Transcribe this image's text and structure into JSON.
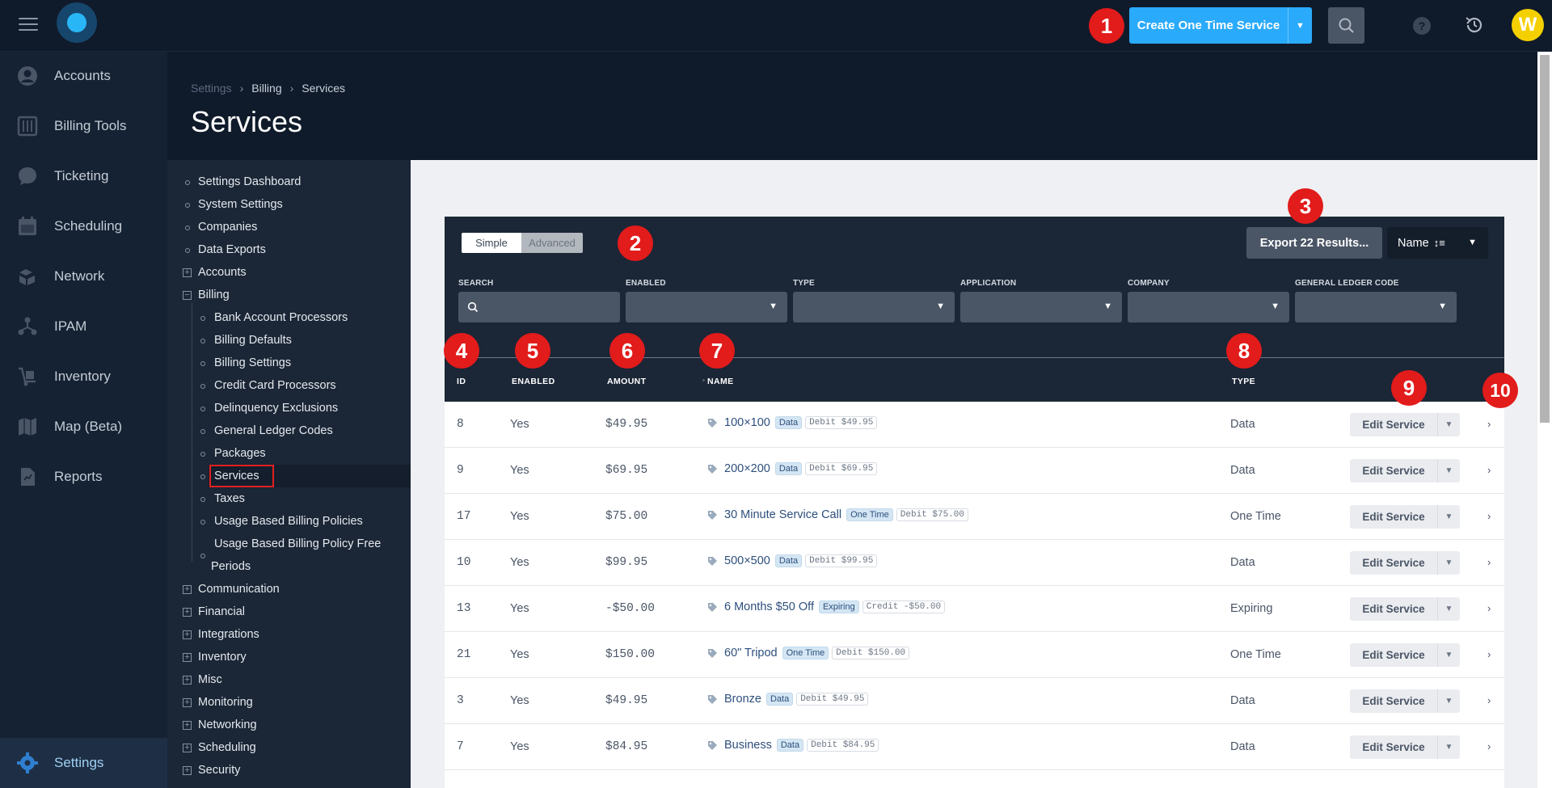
{
  "topbar": {
    "create_button": "Create One Time Service",
    "avatar_initial": "W",
    "help": "?"
  },
  "annotations": [
    "1",
    "2",
    "3",
    "4",
    "5",
    "6",
    "7",
    "8",
    "9",
    "10"
  ],
  "leftnav": {
    "items": [
      "Accounts",
      "Billing Tools",
      "Ticketing",
      "Scheduling",
      "Network",
      "IPAM",
      "Inventory",
      "Map (Beta)",
      "Reports"
    ],
    "settings": "Settings"
  },
  "header": {
    "breadcrumb": [
      "Settings",
      "Billing",
      "Services"
    ],
    "title": "Services"
  },
  "tree": {
    "top": [
      "Settings Dashboard",
      "System Settings",
      "Companies",
      "Data Exports"
    ],
    "accounts": "Accounts",
    "billing": "Billing",
    "billing_children": [
      "Bank Account Processors",
      "Billing Defaults",
      "Billing Settings",
      "Credit Card Processors",
      "Delinquency Exclusions",
      "General Ledger Codes",
      "Packages",
      "Services",
      "Taxes",
      "Usage Based Billing Policies",
      "Usage Based Billing Policy Free",
      "Periods"
    ],
    "groups": [
      "Communication",
      "Financial",
      "Integrations",
      "Inventory",
      "Misc",
      "Monitoring",
      "Networking",
      "Scheduling",
      "Security"
    ]
  },
  "toolbar": {
    "simple": "Simple",
    "advanced": "Advanced",
    "export": "Export 22 Results...",
    "sort": "Name"
  },
  "filters": [
    "SEARCH",
    "ENABLED",
    "TYPE",
    "APPLICATION",
    "COMPANY",
    "GENERAL LEDGER CODE"
  ],
  "columns": {
    "id": "ID",
    "enabled": "ENABLED",
    "amount": "AMOUNT",
    "name": "NAME",
    "type": "TYPE"
  },
  "rows": [
    {
      "id": "8",
      "enabled": "Yes",
      "amount": "$49.95",
      "name": "100×100",
      "tag": "Data",
      "debit": "Debit $49.95",
      "type": "Data",
      "action": "Edit Service"
    },
    {
      "id": "9",
      "enabled": "Yes",
      "amount": "$69.95",
      "name": "200×200",
      "tag": "Data",
      "debit": "Debit $69.95",
      "type": "Data",
      "action": "Edit Service"
    },
    {
      "id": "17",
      "enabled": "Yes",
      "amount": "$75.00",
      "name": "30 Minute Service Call",
      "tag": "One Time",
      "debit": "Debit $75.00",
      "type": "One Time",
      "action": "Edit Service"
    },
    {
      "id": "10",
      "enabled": "Yes",
      "amount": "$99.95",
      "name": "500×500",
      "tag": "Data",
      "debit": "Debit $99.95",
      "type": "Data",
      "action": "Edit Service"
    },
    {
      "id": "13",
      "enabled": "Yes",
      "amount": "-$50.00",
      "name": "6 Months $50 Off",
      "tag": "Expiring",
      "debit": "Credit -$50.00",
      "type": "Expiring",
      "action": "Edit Service"
    },
    {
      "id": "21",
      "enabled": "Yes",
      "amount": "$150.00",
      "name": "60\" Tripod",
      "tag": "One Time",
      "debit": "Debit $150.00",
      "type": "One Time",
      "action": "Edit Service"
    },
    {
      "id": "3",
      "enabled": "Yes",
      "amount": "$49.95",
      "name": "Bronze",
      "tag": "Data",
      "debit": "Debit $49.95",
      "type": "Data",
      "action": "Edit Service"
    },
    {
      "id": "7",
      "enabled": "Yes",
      "amount": "$84.95",
      "name": "Business",
      "tag": "Data",
      "debit": "Debit $84.95",
      "type": "Data",
      "action": "Edit Service"
    }
  ],
  "colors": {
    "accent": "#2aaafa",
    "badge": "#e21b1b",
    "navy": "#0f1a2a"
  }
}
